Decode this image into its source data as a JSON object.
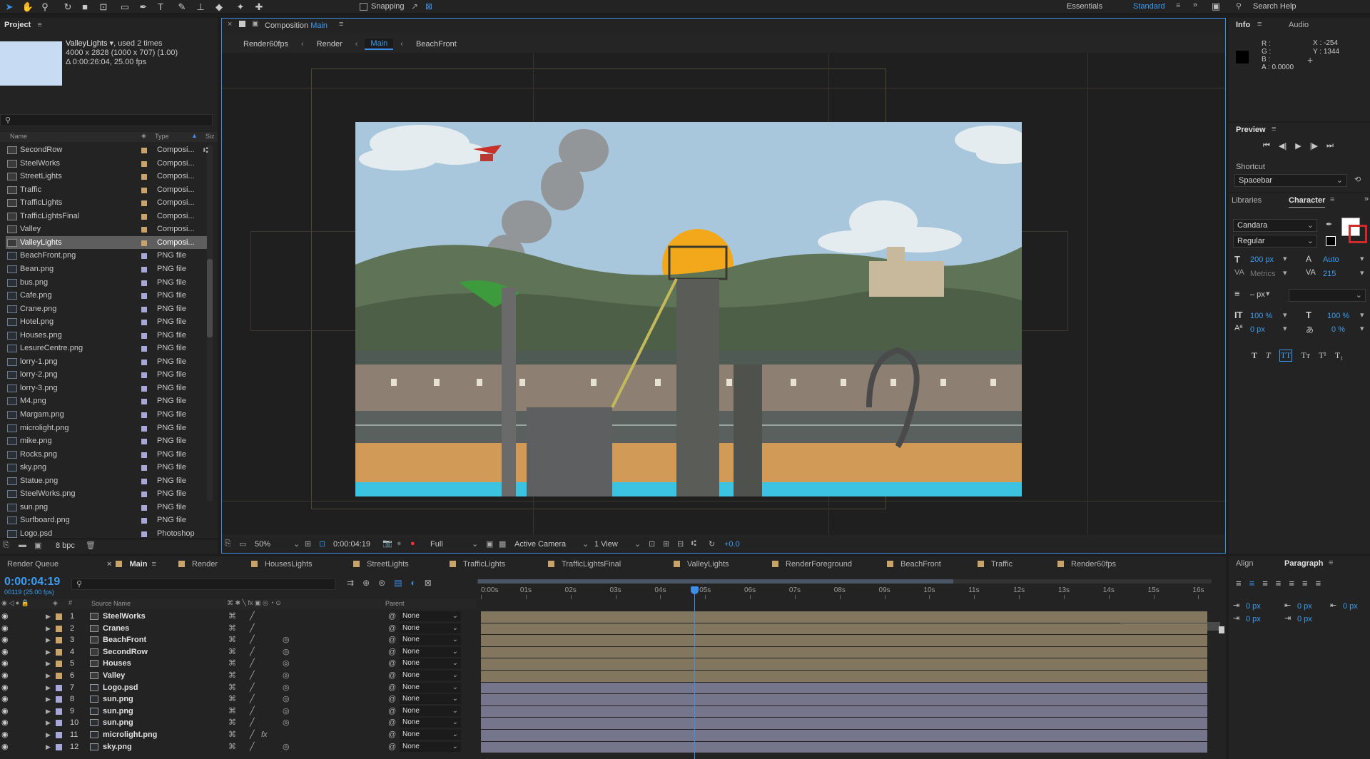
{
  "toolbar": {
    "snapping_label": "Snapping",
    "workspace_essentials": "Essentials",
    "workspace_standard": "Standard",
    "search_placeholder": "Search Help"
  },
  "project": {
    "panel_title": "Project",
    "selected_name": "ValleyLights",
    "selected_used": ", used 2 times",
    "selected_dims": "4000 x 2828  (1000 x 707) (1.00)",
    "selected_duration": "Δ 0:00:26:04, 25.00 fps",
    "search_placeholder": "",
    "col_name": "Name",
    "col_type": "Type",
    "col_size": "Siz",
    "items": [
      {
        "name": "SecondRow",
        "type": "Composi...",
        "kind": "comp",
        "color": "#c8a36a"
      },
      {
        "name": "SteelWorks",
        "type": "Composi...",
        "kind": "comp",
        "color": "#c8a36a"
      },
      {
        "name": "StreetLights",
        "type": "Composi...",
        "kind": "comp",
        "color": "#c8a36a"
      },
      {
        "name": "Traffic",
        "type": "Composi...",
        "kind": "comp",
        "color": "#c8a36a"
      },
      {
        "name": "TrafficLights",
        "type": "Composi...",
        "kind": "comp",
        "color": "#c8a36a"
      },
      {
        "name": "TrafficLightsFinal",
        "type": "Composi...",
        "kind": "comp",
        "color": "#c8a36a"
      },
      {
        "name": "Valley",
        "type": "Composi...",
        "kind": "comp",
        "color": "#c8a36a"
      },
      {
        "name": "ValleyLights",
        "type": "Composi...",
        "kind": "comp",
        "color": "#c8a36a",
        "selected": true
      },
      {
        "name": "BeachFront.png",
        "type": "PNG file",
        "kind": "png",
        "color": "#a8a8d8"
      },
      {
        "name": "Bean.png",
        "type": "PNG file",
        "kind": "png",
        "color": "#a8a8d8"
      },
      {
        "name": "bus.png",
        "type": "PNG file",
        "kind": "png",
        "color": "#a8a8d8"
      },
      {
        "name": "Cafe.png",
        "type": "PNG file",
        "kind": "png",
        "color": "#a8a8d8"
      },
      {
        "name": "Crane.png",
        "type": "PNG file",
        "kind": "png",
        "color": "#a8a8d8"
      },
      {
        "name": "Hotel.png",
        "type": "PNG file",
        "kind": "png",
        "color": "#a8a8d8"
      },
      {
        "name": "Houses.png",
        "type": "PNG file",
        "kind": "png",
        "color": "#a8a8d8"
      },
      {
        "name": "LesureCentre.png",
        "type": "PNG file",
        "kind": "png",
        "color": "#a8a8d8"
      },
      {
        "name": "lorry-1.png",
        "type": "PNG file",
        "kind": "png",
        "color": "#a8a8d8"
      },
      {
        "name": "lorry-2.png",
        "type": "PNG file",
        "kind": "png",
        "color": "#a8a8d8"
      },
      {
        "name": "lorry-3.png",
        "type": "PNG file",
        "kind": "png",
        "color": "#a8a8d8"
      },
      {
        "name": "M4.png",
        "type": "PNG file",
        "kind": "png",
        "color": "#a8a8d8"
      },
      {
        "name": "Margam.png",
        "type": "PNG file",
        "kind": "png",
        "color": "#a8a8d8"
      },
      {
        "name": "microlight.png",
        "type": "PNG file",
        "kind": "png",
        "color": "#a8a8d8"
      },
      {
        "name": "mike.png",
        "type": "PNG file",
        "kind": "png",
        "color": "#a8a8d8"
      },
      {
        "name": "Rocks.png",
        "type": "PNG file",
        "kind": "png",
        "color": "#a8a8d8"
      },
      {
        "name": "sky.png",
        "type": "PNG file",
        "kind": "png",
        "color": "#a8a8d8"
      },
      {
        "name": "Statue.png",
        "type": "PNG file",
        "kind": "png",
        "color": "#a8a8d8"
      },
      {
        "name": "SteelWorks.png",
        "type": "PNG file",
        "kind": "png",
        "color": "#a8a8d8"
      },
      {
        "name": "sun.png",
        "type": "PNG file",
        "kind": "png",
        "color": "#a8a8d8"
      },
      {
        "name": "Surfboard.png",
        "type": "PNG file",
        "kind": "png",
        "color": "#a8a8d8"
      },
      {
        "name": "Logo.psd",
        "type": "Photoshop",
        "kind": "psd",
        "color": "#a8a8d8"
      }
    ],
    "bpc": "8 bpc"
  },
  "viewer": {
    "tab_prefix": "Composition",
    "tab_name": "Main",
    "breadcrumbs": [
      "Render60fps",
      "Render",
      "Main",
      "BeachFront"
    ],
    "active_crumb": "Main",
    "zoom": "50%",
    "timecode": "0:00:04:19",
    "resolution": "Full",
    "camera": "Active Camera",
    "views": "1 View",
    "exposure": "+0.0"
  },
  "info": {
    "tab_info": "Info",
    "tab_audio": "Audio",
    "r": "R :",
    "g": "G :",
    "b": "B :",
    "a": "A : 0.0000",
    "x": "X : -254",
    "y": "Y : 1344"
  },
  "preview": {
    "title": "Preview",
    "shortcut_label": "Shortcut",
    "shortcut_value": "Spacebar"
  },
  "character": {
    "tab_libraries": "Libraries",
    "tab_character": "Character",
    "font": "Candara",
    "style": "Regular",
    "size": "200 px",
    "leading": "Auto",
    "kerning": "Metrics",
    "tracking": "215",
    "stroke": "– px",
    "vscale": "100 %",
    "hscale": "100 %",
    "baseline": "0 px",
    "tsume": "0 %"
  },
  "paragraph": {
    "tab_align": "Align",
    "tab_paragraph": "Paragraph",
    "indent_left": "0 px",
    "indent_first": "0 px",
    "space_before": "0 px",
    "indent_right": "0 px",
    "space_after": "0 px"
  },
  "timeline": {
    "tabs": [
      {
        "label": "Render Queue",
        "color": ""
      },
      {
        "label": "Main",
        "color": "#c8a36a",
        "active": true
      },
      {
        "label": "Render",
        "color": "#c8a36a"
      },
      {
        "label": "HousesLights",
        "color": "#c8a36a"
      },
      {
        "label": "StreetLights",
        "color": "#c8a36a"
      },
      {
        "label": "TrafficLights",
        "color": "#c8a36a"
      },
      {
        "label": "TrafficLightsFinal",
        "color": "#c8a36a"
      },
      {
        "label": "ValleyLights",
        "color": "#c8a36a"
      },
      {
        "label": "RenderForeground",
        "color": "#c8a36a"
      },
      {
        "label": "BeachFront",
        "color": "#c8a36a"
      },
      {
        "label": "Traffic",
        "color": "#c8a36a"
      },
      {
        "label": "Render60fps",
        "color": "#c8a36a"
      }
    ],
    "timecode": "0:00:04:19",
    "frame_info": "00119 (25.00 fps)",
    "col_source": "Source Name",
    "col_parent": "Parent",
    "ruler": [
      "0:00s",
      "01s",
      "02s",
      "03s",
      "04s",
      "05s",
      "06s",
      "07s",
      "08s",
      "09s",
      "10s",
      "11s",
      "12s",
      "13s",
      "14s",
      "15s",
      "16s"
    ],
    "playhead_seconds": 4.76,
    "duration_seconds": 16.2,
    "layers": [
      {
        "num": "1",
        "name": "SteelWorks",
        "kind": "comp",
        "color": "#c8a36a",
        "parent": "None",
        "fx": false
      },
      {
        "num": "2",
        "name": "Cranes",
        "kind": "comp",
        "color": "#c8a36a",
        "parent": "None",
        "fx": false
      },
      {
        "num": "3",
        "name": "BeachFront",
        "kind": "comp",
        "color": "#c8a36a",
        "parent": "None",
        "fx": false
      },
      {
        "num": "4",
        "name": "SecondRow",
        "kind": "comp",
        "color": "#c8a36a",
        "parent": "None",
        "fx": false
      },
      {
        "num": "5",
        "name": "Houses",
        "kind": "comp",
        "color": "#c8a36a",
        "parent": "None",
        "fx": false
      },
      {
        "num": "6",
        "name": "Valley",
        "kind": "comp",
        "color": "#c8a36a",
        "parent": "None",
        "fx": false
      },
      {
        "num": "7",
        "name": "Logo.psd",
        "kind": "psd",
        "color": "#a8a8d8",
        "parent": "None",
        "fx": false
      },
      {
        "num": "8",
        "name": "sun.png",
        "kind": "png",
        "color": "#a8a8d8",
        "parent": "None",
        "fx": false
      },
      {
        "num": "9",
        "name": "sun.png",
        "kind": "png",
        "color": "#a8a8d8",
        "parent": "None",
        "fx": false
      },
      {
        "num": "10",
        "name": "sun.png",
        "kind": "png",
        "color": "#a8a8d8",
        "parent": "None",
        "fx": false
      },
      {
        "num": "11",
        "name": "microlight.png",
        "kind": "png",
        "color": "#a8a8d8",
        "parent": "None",
        "fx": true
      },
      {
        "num": "12",
        "name": "sky.png",
        "kind": "png",
        "color": "#a8a8d8",
        "parent": "None",
        "fx": false
      }
    ]
  },
  "colors": {
    "accent": "#3d8ee8",
    "comp_label": "#c8a36a",
    "footage_label": "#a8a8d8",
    "bar_comp": "#82765f",
    "bar_footage": "#75768c"
  }
}
